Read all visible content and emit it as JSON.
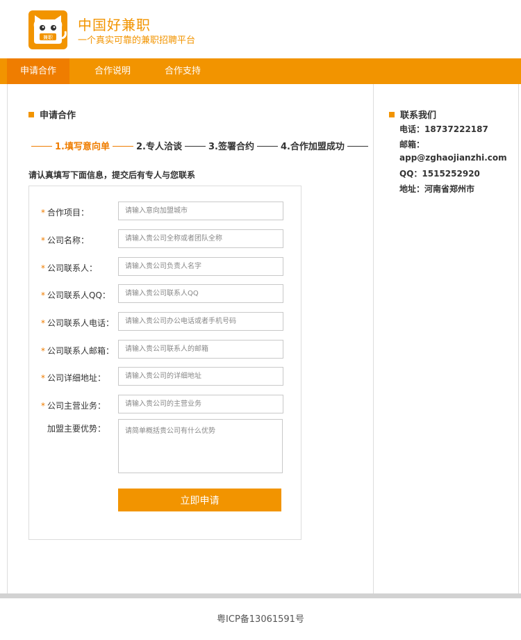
{
  "brand": {
    "title": "中国好兼职",
    "subtitle": "一个真实可靠的兼职招聘平台",
    "logo_text": "兼职",
    "color": "#f29400"
  },
  "nav": {
    "items": [
      "申请合作",
      "合作说明",
      "合作支持"
    ],
    "active_index": 0,
    "active_color": "#ef7d00"
  },
  "main": {
    "section_title": "申请合作",
    "steps": [
      "1.填写意向单",
      "2.专人洽谈",
      "3.签署合约",
      "4.合作加盟成功"
    ],
    "hint": "请认真填写下面信息，提交后有专人与您联系",
    "fields": [
      {
        "label": "合作项目：",
        "placeholder": "请输入意向加盟城市",
        "required": true
      },
      {
        "label": "公司名称：",
        "placeholder": "请输入贵公司全称或者团队全称",
        "required": true
      },
      {
        "label": "公司联系人：",
        "placeholder": "请输入贵公司负责人名字",
        "required": true
      },
      {
        "label": "公司联系人QQ：",
        "placeholder": "请输入贵公司联系人QQ",
        "required": true
      },
      {
        "label": "公司联系人电话：",
        "placeholder": "请输入贵公司办公电话或者手机号码",
        "required": true
      },
      {
        "label": "公司联系人邮箱：",
        "placeholder": "请输入贵公司联系人的邮箱",
        "required": true
      },
      {
        "label": "公司详细地址：",
        "placeholder": "请输入贵公司的详细地址",
        "required": true
      },
      {
        "label": "公司主营业务：",
        "placeholder": "请输入贵公司的主营业务",
        "required": true
      }
    ],
    "advantage": {
      "label": "加盟主要优势：",
      "placeholder": "请简单概括贵公司有什么优势"
    },
    "required_mark": "*",
    "submit_label": "立即申请"
  },
  "sidebar": {
    "title": "联系我们",
    "lines": [
      "电话：18737222187",
      "邮箱：",
      "app@zghaojianzhi.com",
      "QQ：1515252920",
      "地址：河南省郑州市"
    ]
  },
  "footer": {
    "icp": "粤ICP备13061591号"
  }
}
